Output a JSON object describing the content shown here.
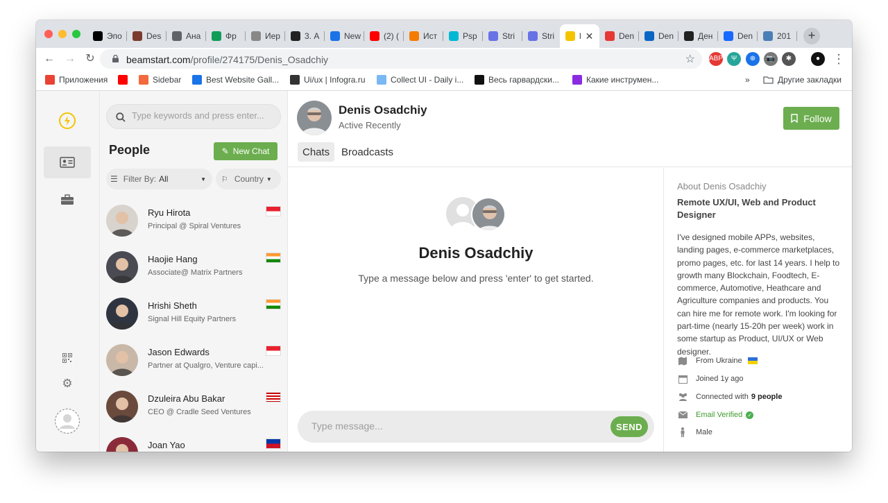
{
  "browser": {
    "tabs": [
      {
        "label": "Эпо",
        "color": "#000000"
      },
      {
        "label": "Des",
        "color": "#7a3b2e"
      },
      {
        "label": "Ана",
        "color": "#5f6368"
      },
      {
        "label": "Фр",
        "color": "#0f9d58"
      },
      {
        "label": "Иер",
        "color": "#888888"
      },
      {
        "label": "3. А",
        "color": "#222222"
      },
      {
        "label": "New",
        "color": "#1a73e8"
      },
      {
        "label": "(2) (",
        "color": "#ff0000"
      },
      {
        "label": "Ист",
        "color": "#f57c00"
      },
      {
        "label": "Psp",
        "color": "#00b8d4"
      },
      {
        "label": "Stri",
        "color": "#6772e5"
      },
      {
        "label": "Stri",
        "color": "#6772e5"
      },
      {
        "label": "l",
        "color": "#f5c400"
      },
      {
        "label": "Den",
        "color": "#e53935"
      },
      {
        "label": "Den",
        "color": "#0a66c2"
      },
      {
        "label": "Ден",
        "color": "#222222"
      },
      {
        "label": "Den",
        "color": "#1769ff"
      },
      {
        "label": "201",
        "color": "#4a7fb5"
      }
    ],
    "new_tab_label": "+",
    "close_tab_label": "✕",
    "url_host": "beamstart.com",
    "url_path": "/profile/274175/Denis_Osadchiy",
    "extensions": [
      "ABP",
      "Ψ",
      "⊕",
      "📷",
      "✱",
      "●"
    ],
    "bookmarks": [
      {
        "label": "Приложения",
        "color": "#ea4335"
      },
      {
        "label": "",
        "color": "#ff0000"
      },
      {
        "label": "Sidebar",
        "color": "#f26a3d"
      },
      {
        "label": "Best Website Gall...",
        "color": "#1a73e8"
      },
      {
        "label": "Ui/ux | Infogra.ru",
        "color": "#333333"
      },
      {
        "label": "Collect UI - Daily i...",
        "color": "#7ab8f5"
      },
      {
        "label": "Весь гарвардски...",
        "color": "#111111"
      },
      {
        "label": "Какие инструмен...",
        "color": "#8a2be2"
      }
    ],
    "bookmarks_more": "»",
    "other_bookmarks": "Другие закладки"
  },
  "rail": {
    "logo_color": "#f5c400"
  },
  "people_panel": {
    "search_placeholder": "Type keywords and press enter...",
    "title": "People",
    "new_chat_label": "New Chat",
    "filter_label": "Filter By:",
    "filter_value": "All",
    "country_label": "Country",
    "people": [
      {
        "name": "Ryu Hirota",
        "role": "Principal @ Spiral Ventures",
        "flag": "sg",
        "avatar_bg": "#d8d3cc"
      },
      {
        "name": "Haojie Hang",
        "role": "Associate@ Matrix Partners",
        "flag": "in",
        "avatar_bg": "#4a4a52"
      },
      {
        "name": "Hrishi Sheth",
        "role": "Signal Hill Equity Partners",
        "flag": "in",
        "avatar_bg": "#2f3540"
      },
      {
        "name": "Jason Edwards",
        "role": "Partner at Qualgro, Venture capi...",
        "flag": "sg",
        "avatar_bg": "#c9b8a8"
      },
      {
        "name": "Dzuleira Abu Bakar",
        "role": "CEO @ Cradle Seed Ventures",
        "flag": "my",
        "avatar_bg": "#6b4a3e"
      },
      {
        "name": "Joan Yao",
        "role": "",
        "flag": "ph",
        "avatar_bg": "#8b2b3a"
      }
    ]
  },
  "chat": {
    "name": "Denis Osadchiy",
    "status": "Active Recently",
    "follow_label": "Follow",
    "tabs": [
      "Chats",
      "Broadcasts"
    ],
    "empty_name": "Denis Osadchiy",
    "empty_hint": "Type a message below and press 'enter' to get started.",
    "message_placeholder": "Type message...",
    "send_label": "SEND"
  },
  "about": {
    "title": "About Denis Osadchiy",
    "headline": "Remote UX/UI, Web and Product Designer",
    "bio": "I've designed mobile APPs, websites, landing pages, e-commerce marketplaces, promo pages, etc. for last 14 years. I help to growth many Blockchain, Foodtech, E-commerce, Automotive, Heathcare and Agriculture companies and products. You can hire me for remote work. I'm looking for part-time (nearly 15-20h per week) work in some startup as Product, UI/UX or Web designer.",
    "from": "From Ukraine",
    "joined": "Joined 1y ago",
    "connected_prefix": "Connected with",
    "connected_count": "9 people",
    "verified": "Email Verified",
    "gender": "Male"
  },
  "colors": {
    "accent": "#6cae4f",
    "panel_bg": "#f5f5f5"
  }
}
